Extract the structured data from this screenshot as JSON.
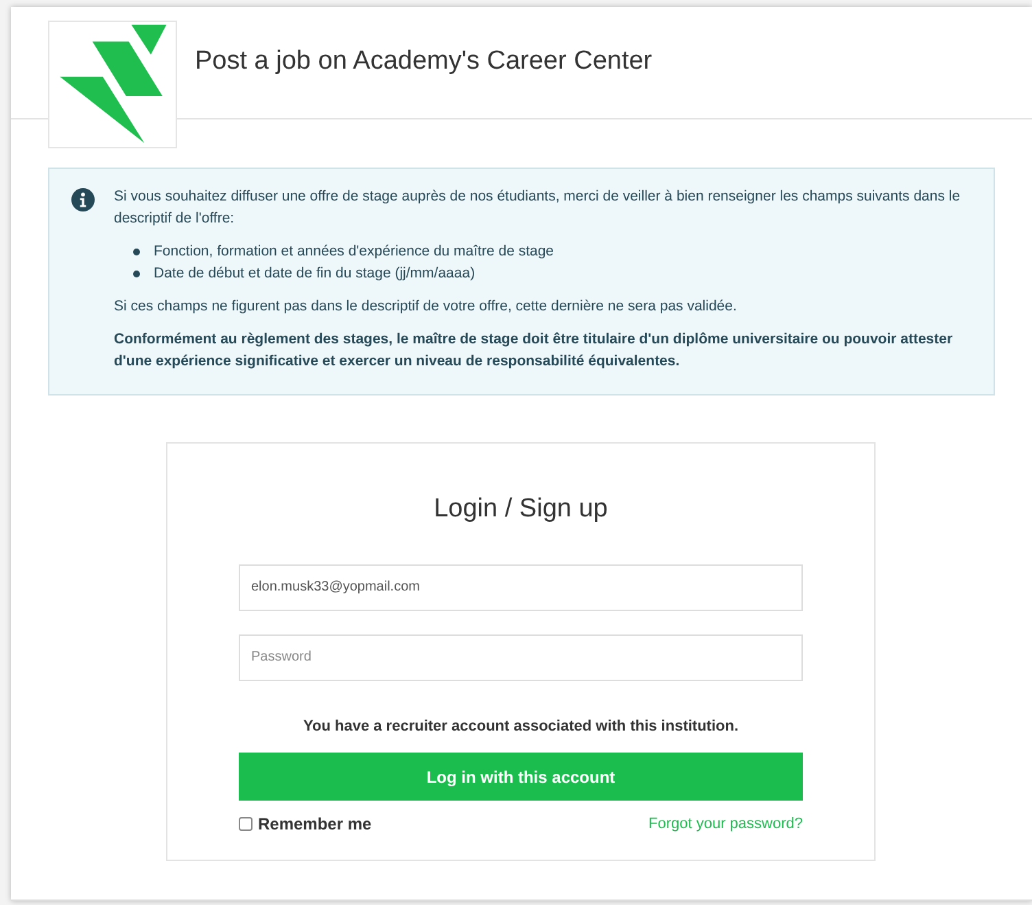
{
  "header": {
    "title": "Post a job on Academy's Career Center"
  },
  "notice": {
    "intro": "Si vous souhaitez diffuser une offre de stage auprès de nos étudiants, merci de veiller à bien renseigner les champs suivants dans le descriptif de l'offre:",
    "items": [
      "Fonction, formation et années d'expérience du maître de stage",
      "Date de début et date de fin du stage (jj/mm/aaaa)"
    ],
    "warning": "Si ces champs ne figurent pas dans le descriptif de votre offre, cette dernière ne sera pas validée.",
    "rule": "Conformément au règlement des stages, le maître de stage doit être titulaire d'un diplôme universitaire ou pouvoir attester d'une expérience significative et exercer un niveau de responsabilité équivalentes."
  },
  "login": {
    "title": "Login / Sign up",
    "email": {
      "value": "elon.musk33@yopmail.com"
    },
    "password": {
      "placeholder": "Password"
    },
    "message": "You have a recruiter account associated with this institution.",
    "button": "Log in with this account",
    "remember": {
      "label": "Remember me",
      "checked": false
    },
    "forgot": "Forgot your password?"
  }
}
